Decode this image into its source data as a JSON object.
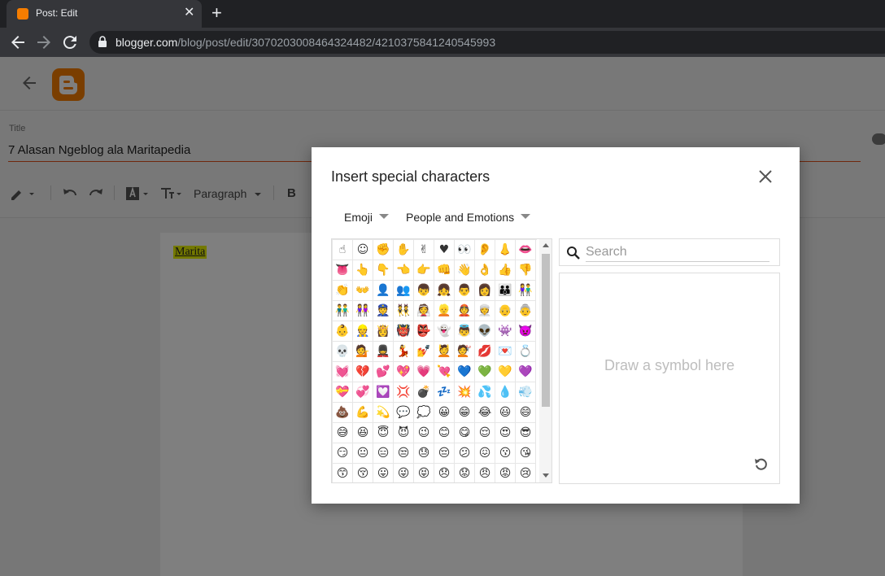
{
  "browser": {
    "tab_title": "Post: Edit",
    "tab_close": "✕",
    "new_tab": "+",
    "url_host": "blogger.com",
    "url_path": "/blog/post/edit/3070203008464324482/4210375841240545993"
  },
  "post": {
    "title_label": "Title",
    "title_value": "7 Alasan Ngeblog ala Maritapedia",
    "body_text": "Marita"
  },
  "editor_toolbar": {
    "paragraph_label": "Paragraph",
    "bold_label": "B"
  },
  "dialog": {
    "title": "Insert special characters",
    "category": "Emoji",
    "subcategory": "People and Emotions",
    "search_placeholder": "Search",
    "draw_hint": "Draw a symbol here",
    "symbols": [
      "☝",
      "☺",
      "✊",
      "✋",
      "✌",
      "♥",
      "👀",
      "👂",
      "👃",
      "👄",
      "👅",
      "👆",
      "👇",
      "👈",
      "👉",
      "👊",
      "👋",
      "👌",
      "👍",
      "👎",
      "👏",
      "👐",
      "👤",
      "👥",
      "👦",
      "👧",
      "👨",
      "👩",
      "👪",
      "👫",
      "👬",
      "👭",
      "👮",
      "👯",
      "👰",
      "👱",
      "👲",
      "👳",
      "👴",
      "👵",
      "👶",
      "👷",
      "👸",
      "👹",
      "👺",
      "👻",
      "👼",
      "👽",
      "👾",
      "👿",
      "💀",
      "💁",
      "💂",
      "💃",
      "💅",
      "💆",
      "💇",
      "💋",
      "💌",
      "💍",
      "💓",
      "💔",
      "💕",
      "💖",
      "💗",
      "💘",
      "💙",
      "💚",
      "💛",
      "💜",
      "💝",
      "💞",
      "💟",
      "💢",
      "💣",
      "💤",
      "💥",
      "💦",
      "💧",
      "💨",
      "💩",
      "💪",
      "💫",
      "💬",
      "💭",
      "😀",
      "😁",
      "😂",
      "😃",
      "😄",
      "😅",
      "😆",
      "😇",
      "😈",
      "😉",
      "😊",
      "😋",
      "😌",
      "😍",
      "😎",
      "😏",
      "😐",
      "😑",
      "😒",
      "😓",
      "😔",
      "😕",
      "😖",
      "😗",
      "😘",
      "😙",
      "😚",
      "😛",
      "😜",
      "😝",
      "😞",
      "😟",
      "😠",
      "😡",
      "😢"
    ]
  }
}
